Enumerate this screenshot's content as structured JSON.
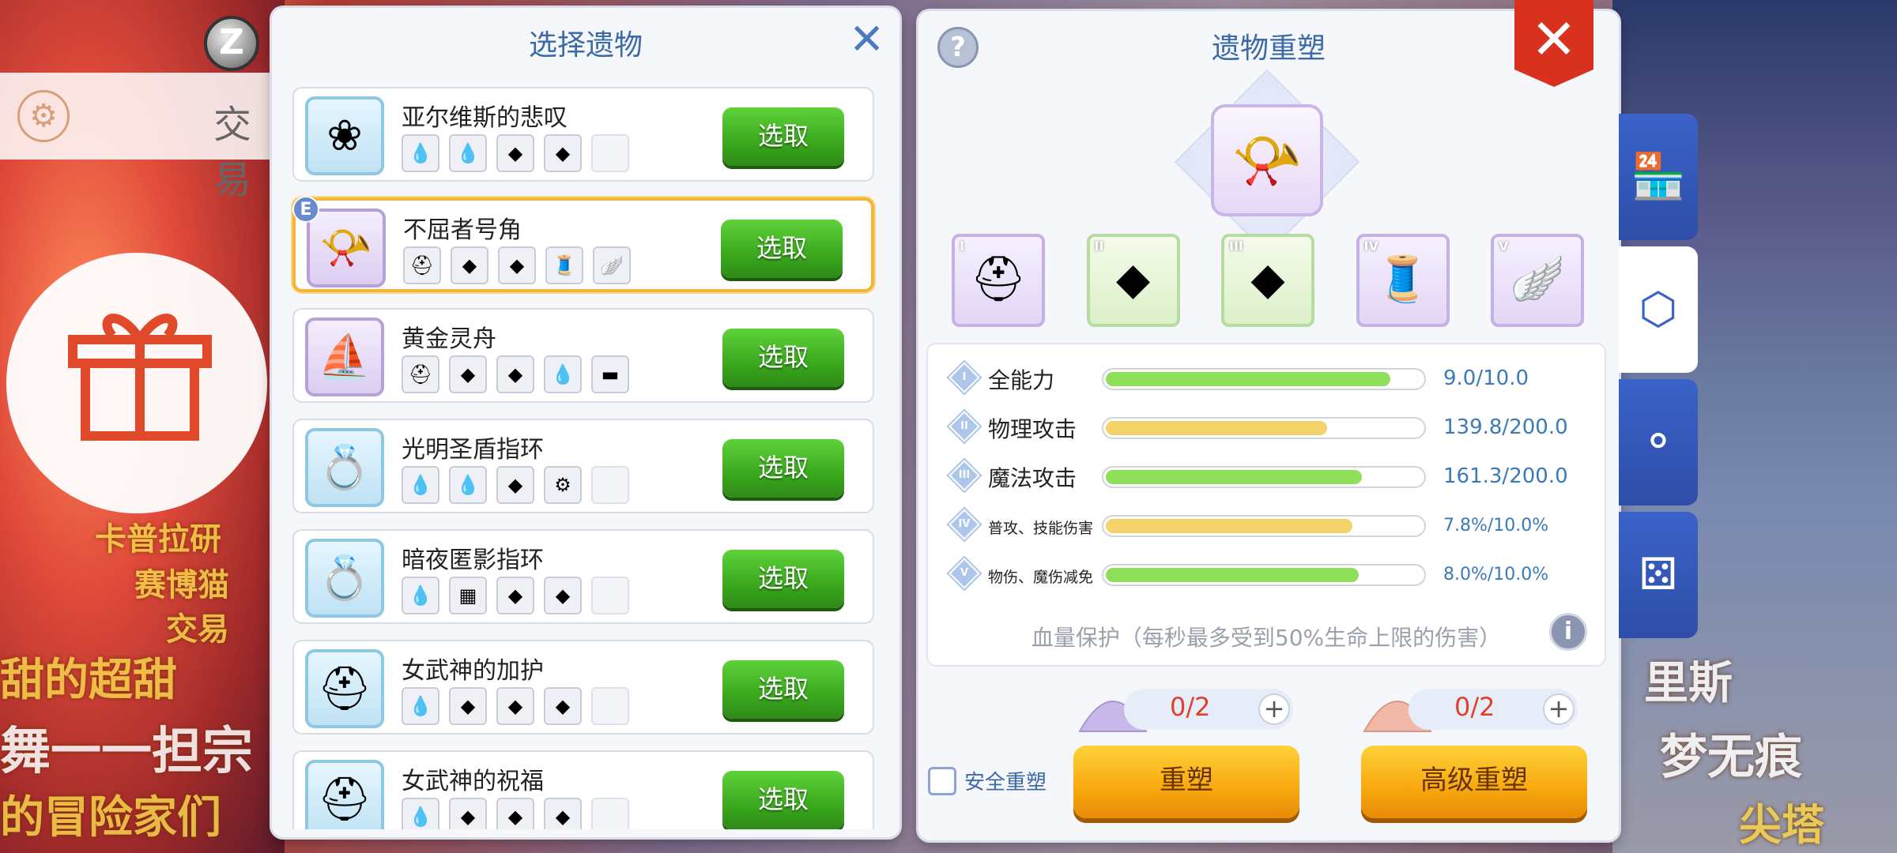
{
  "background": {
    "trade_label": "交易",
    "scribbles": [
      "卡普拉研",
      "赛博猫",
      "交易",
      "甜的超甜",
      "舞一一担宗",
      "的冒险家们",
      "里斯",
      "梦无痕",
      "尖塔"
    ]
  },
  "left_panel": {
    "title": "选择遗物",
    "close_icon": "close-icon",
    "items": [
      {
        "name": "亚尔维斯的悲叹",
        "icon": "cloud-wreath-icon",
        "selected": false,
        "badge": "",
        "mats": [
          "💧",
          "💧",
          "◆",
          "◆",
          ""
        ]
      },
      {
        "name": "不屈者号角",
        "icon": "horn-icon",
        "selected": true,
        "badge": "E",
        "mats": [
          "⛑",
          "◆",
          "◆",
          "🧵",
          "🪽"
        ]
      },
      {
        "name": "黄金灵舟",
        "icon": "golden-boat-icon",
        "selected": false,
        "badge": "",
        "mats": [
          "⛑",
          "◆",
          "◆",
          "💧",
          "▬"
        ]
      },
      {
        "name": "光明圣盾指环",
        "icon": "ring-icon",
        "selected": false,
        "badge": "",
        "mats": [
          "💧",
          "💧",
          "◆",
          "⚙",
          ""
        ]
      },
      {
        "name": "暗夜匿影指环",
        "icon": "ring-icon",
        "selected": false,
        "badge": "",
        "mats": [
          "💧",
          "▦",
          "◆",
          "◆",
          ""
        ]
      },
      {
        "name": "女武神的加护",
        "icon": "helmet-icon",
        "selected": false,
        "badge": "",
        "mats": [
          "💧",
          "◆",
          "◆",
          "◆",
          ""
        ]
      },
      {
        "name": "女武神的祝福",
        "icon": "helmet-icon",
        "selected": false,
        "badge": "",
        "mats": [
          "💧",
          "◆",
          "◆",
          "◆",
          ""
        ]
      }
    ],
    "pick_label": "选取"
  },
  "right_panel": {
    "title": "遗物重塑",
    "hero_icon": "horn-icon",
    "slots": [
      {
        "numeral": "I",
        "icon": "horned-helmet-icon",
        "tint": "purple",
        "glyph": "⛑"
      },
      {
        "numeral": "II",
        "icon": "crystal-icon",
        "tint": "green",
        "glyph": "◆"
      },
      {
        "numeral": "III",
        "icon": "ore-icon",
        "tint": "green",
        "glyph": "◆"
      },
      {
        "numeral": "IV",
        "icon": "thread-spool-icon",
        "tint": "purple",
        "glyph": "🧵"
      },
      {
        "numeral": "V",
        "icon": "wings-icon",
        "tint": "purple",
        "glyph": "🪽"
      }
    ],
    "stats": [
      {
        "numeral": "I",
        "name": "全能力",
        "value": "9.0/10.0",
        "fraction": 0.9,
        "color": "#8ee05a",
        "small": false
      },
      {
        "numeral": "II",
        "name": "物理攻击",
        "value": "139.8/200.0",
        "fraction": 0.7,
        "color": "#f3d36a",
        "small": false
      },
      {
        "numeral": "III",
        "name": "魔法攻击",
        "value": "161.3/200.0",
        "fraction": 0.81,
        "color": "#8ee05a",
        "small": false
      },
      {
        "numeral": "IV",
        "name": "普攻、技能伤害",
        "value": "7.8%/10.0%",
        "fraction": 0.78,
        "color": "#f3d36a",
        "small": true
      },
      {
        "numeral": "V",
        "name": "物伤、魔伤减免",
        "value": "8.0%/10.0%",
        "fraction": 0.8,
        "color": "#8ee05a",
        "small": true
      }
    ],
    "protection": "血量保护（每秒最多受到50%生命上限的伤害）",
    "resources": [
      {
        "count": "0/2",
        "color": "#c8b8ea"
      },
      {
        "count": "0/2",
        "color": "#f2b8a8"
      }
    ],
    "safe_label": "安全重塑",
    "reforge_label": "重塑",
    "adv_reforge_label": "高级重塑"
  },
  "side_tabs": [
    {
      "icon": "shop-icon",
      "glyph": "🏪",
      "active": false
    },
    {
      "icon": "hexagon-cluster-icon",
      "glyph": "⬡",
      "active": true
    },
    {
      "icon": "nodes-icon",
      "glyph": "⚬",
      "active": false
    },
    {
      "icon": "dice-icon",
      "glyph": "⚄",
      "active": false
    }
  ]
}
